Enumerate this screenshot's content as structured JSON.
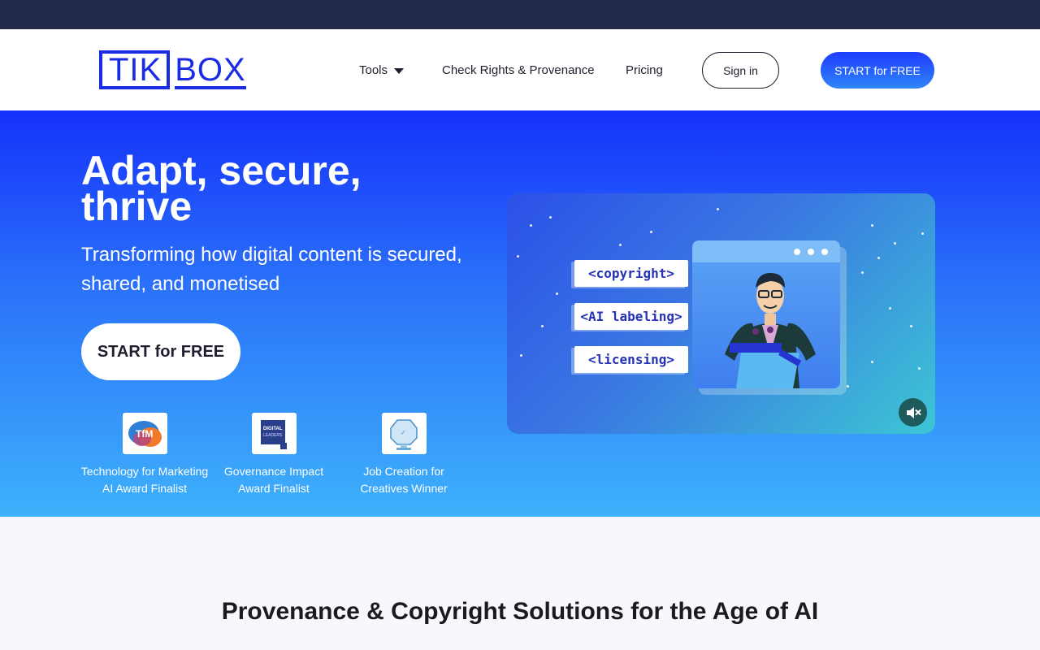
{
  "brand": {
    "logo_left": "TIK",
    "logo_right": "BOX",
    "accent_color": "#1a2be6"
  },
  "nav": {
    "tools_label": "Tools",
    "rights_label": "Check Rights & Provenance",
    "pricing_label": "Pricing",
    "signin_label": "Sign in",
    "start_label": "START for FREE"
  },
  "hero": {
    "title": "Adapt, secure, thrive",
    "subtitle": "Transforming how digital content is secured, shared, and monetised",
    "cta_label": "START for FREE",
    "awards": [
      {
        "label": "Technology for Marketing AI Award Finalist",
        "icon": "tfm-award-icon"
      },
      {
        "label": "Governance Impact Award Finalist",
        "icon": "digital-leaders-icon"
      },
      {
        "label": "Job Creation for Creatives Winner",
        "icon": "trophy-icon"
      }
    ]
  },
  "video": {
    "tags": [
      "<copyright>",
      "<AI labeling>",
      "<licensing>"
    ],
    "mute_icon": "mute-icon"
  },
  "section": {
    "title": "Provenance & Copyright Solutions for the Age of AI"
  }
}
